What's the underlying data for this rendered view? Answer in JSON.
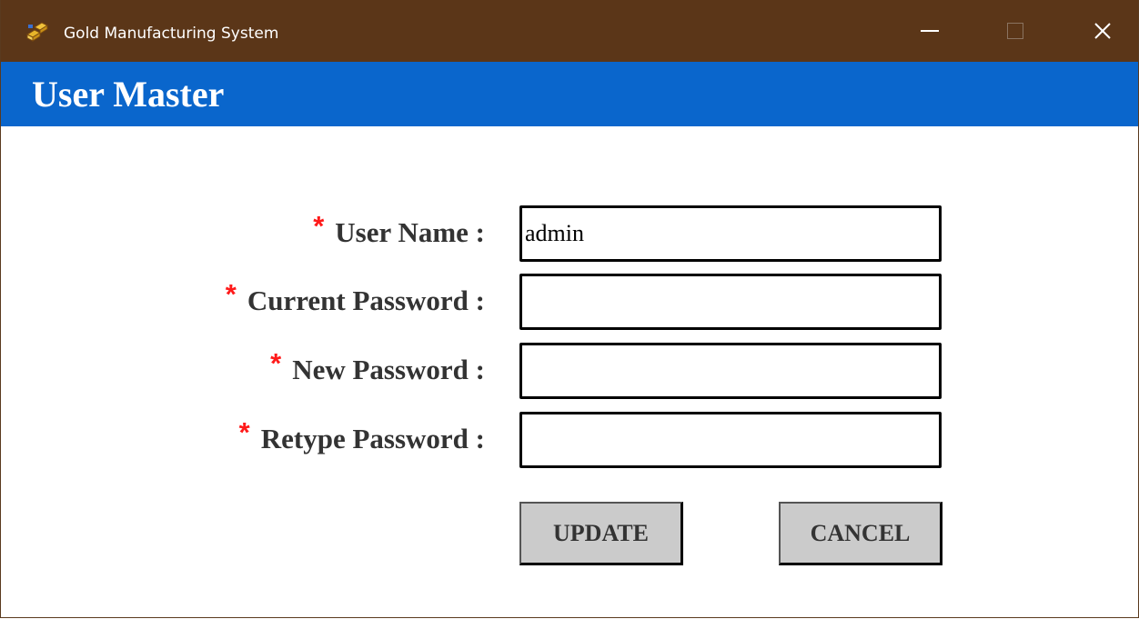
{
  "window": {
    "title": "Gold Manufacturing System",
    "controls": [
      "minimize",
      "maximize",
      "close"
    ],
    "titlebar_color": "#5b3618",
    "app_icon": "gold-bars-icon"
  },
  "header": {
    "title": "User Master",
    "band_color": "#0a66cc"
  },
  "form": {
    "required_marker": "*",
    "fields": [
      {
        "label": "User Name :",
        "value": "admin"
      },
      {
        "label": "Current Password :",
        "value": ""
      },
      {
        "label": "New Password :",
        "value": ""
      },
      {
        "label": "Retype Password :",
        "value": ""
      }
    ],
    "buttons": {
      "update": "UPDATE",
      "cancel": "CANCEL"
    }
  }
}
